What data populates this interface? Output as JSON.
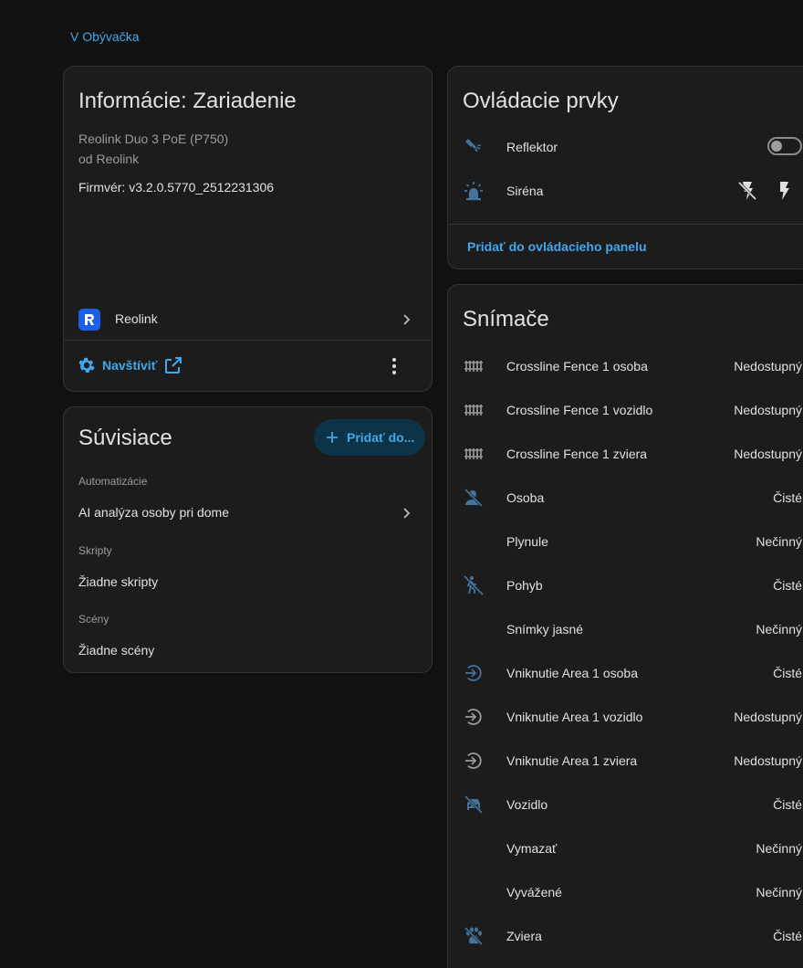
{
  "breadcrumb": "V Obývačka",
  "colors": {
    "background": "#111111",
    "card": "#1c1c1c",
    "accent": "#40a8ea",
    "icon_active": "#44739e",
    "icon_inactive": "#9b9b9b"
  },
  "info": {
    "title": "Informácie: Zariadenie",
    "model": "Reolink Duo 3 PoE (P750)",
    "vendor": "od Reolink",
    "firmware": "Firmvér: v3.2.0.5770_2512231306",
    "integration": "Reolink",
    "visit": "Navštíviť",
    "icons": {
      "integration": "reolink-logo-icon",
      "visit": "gear-icon",
      "external": "open-in-new-icon",
      "more": "more-vertical-icon"
    }
  },
  "related": {
    "title": "Súvisiace",
    "add_button": "Pridať do...",
    "sections": [
      {
        "label": "Automatizácie",
        "item": "AI analýza osoby pri dome"
      },
      {
        "label": "Skripty",
        "item": "Žiadne skripty"
      },
      {
        "label": "Scény",
        "item": "Žiadne scény"
      }
    ]
  },
  "controls": {
    "title": "Ovládacie prvky",
    "items": [
      {
        "label": "Reflektor",
        "icon": "spotlight-icon",
        "toggle_on": false
      },
      {
        "label": "Siréna",
        "icon": "alarm-light-icon",
        "buttons": [
          "flash-off-icon",
          "flash-icon"
        ]
      }
    ],
    "add_to_dashboard": "Pridať do ovládacieho panelu"
  },
  "sensors": {
    "title": "Snímače",
    "items": [
      {
        "label": "Crossline Fence 1 osoba",
        "state": "Nedostupný",
        "icon": "fence-icon"
      },
      {
        "label": "Crossline Fence 1 vozidlo",
        "state": "Nedostupný",
        "icon": "fence-icon"
      },
      {
        "label": "Crossline Fence 1 zviera",
        "state": "Nedostupný",
        "icon": "fence-icon"
      },
      {
        "label": "Osoba",
        "state": "Čisté",
        "icon": "account-off-icon"
      },
      {
        "label": "Plynule",
        "state": "Nečinný",
        "icon": ""
      },
      {
        "label": "Pohyb",
        "state": "Čisté",
        "icon": "motion-sensor-off-icon"
      },
      {
        "label": "Snímky jasné",
        "state": "Nečinný",
        "icon": ""
      },
      {
        "label": "Vniknutie Area 1 osoba",
        "state": "Čisté",
        "icon": "login-circle-icon"
      },
      {
        "label": "Vniknutie Area 1 vozidlo",
        "state": "Nedostupný",
        "icon": "login-circle-icon"
      },
      {
        "label": "Vniknutie Area 1 zviera",
        "state": "Nedostupný",
        "icon": "login-circle-icon"
      },
      {
        "label": "Vozidlo",
        "state": "Čisté",
        "icon": "car-off-icon"
      },
      {
        "label": "Vymazať",
        "state": "Nečinný",
        "icon": ""
      },
      {
        "label": "Vyvážené",
        "state": "Nečinný",
        "icon": ""
      },
      {
        "label": "Zviera",
        "state": "Čisté",
        "icon": "paw-off-icon"
      }
    ]
  }
}
